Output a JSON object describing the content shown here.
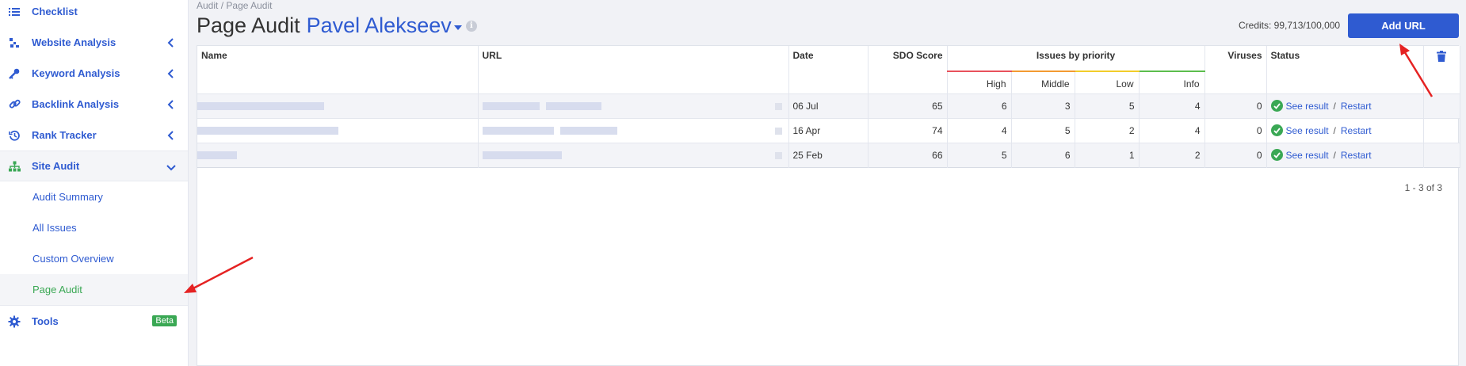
{
  "sidebar": {
    "items": [
      {
        "label": "Checklist",
        "icon": "checklist-icon"
      },
      {
        "label": "Website Analysis",
        "icon": "analysis-icon"
      },
      {
        "label": "Keyword Analysis",
        "icon": "key-icon"
      },
      {
        "label": "Backlink Analysis",
        "icon": "link-icon"
      },
      {
        "label": "Rank Tracker",
        "icon": "history-icon"
      },
      {
        "label": "Site Audit",
        "icon": "sitemap-icon"
      }
    ],
    "site_audit_sub": [
      "Audit Summary",
      "All Issues",
      "Custom Overview",
      "Page Audit"
    ],
    "tools": {
      "label": "Tools",
      "badge": "Beta"
    }
  },
  "header": {
    "breadcrumb": [
      "Audit",
      "Page Audit"
    ],
    "breadcrumb_sep": "/",
    "title": "Page Audit",
    "project": "Pavel Alekseev",
    "credits": "Credits: 99,713/100,000",
    "add_url": "Add URL"
  },
  "table": {
    "columns": {
      "name": "Name",
      "url": "URL",
      "date": "Date",
      "sdo": "SDO Score",
      "issues": "Issues by priority",
      "viruses": "Viruses",
      "status": "Status"
    },
    "priority": [
      "High",
      "Middle",
      "Low",
      "Info"
    ],
    "rows": [
      {
        "date": "06 Jul",
        "sdo": "65",
        "high": "6",
        "middle": "3",
        "low": "5",
        "info": "4",
        "viruses": "0",
        "see": "See result",
        "restart": "Restart"
      },
      {
        "date": "16 Apr",
        "sdo": "74",
        "high": "4",
        "middle": "5",
        "low": "2",
        "info": "4",
        "viruses": "0",
        "see": "See result",
        "restart": "Restart"
      },
      {
        "date": "25 Feb",
        "sdo": "66",
        "high": "5",
        "middle": "6",
        "low": "1",
        "info": "2",
        "viruses": "0",
        "see": "See result",
        "restart": "Restart"
      }
    ],
    "slash": "/",
    "pager": "1 - 3 of 3"
  },
  "colors": {
    "accent": "#2f5bd1",
    "active": "#3aa854",
    "high": "#e8515b",
    "middle": "#f39a31",
    "low": "#f2cd2a",
    "info": "#5bbd4d",
    "annotation": "#e52222"
  }
}
